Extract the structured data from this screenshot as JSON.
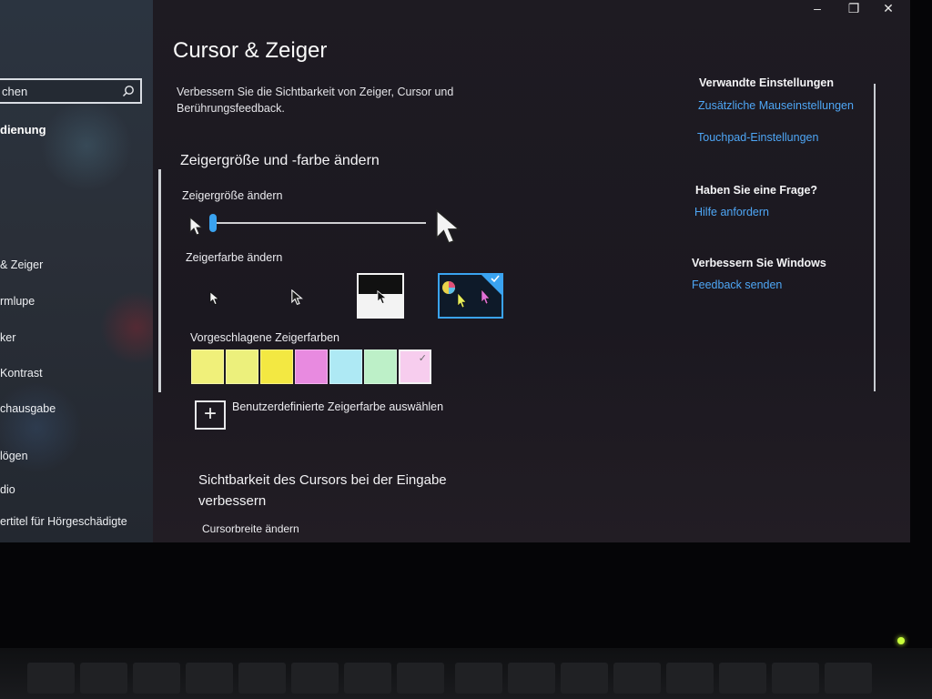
{
  "window": {
    "title": "Cursor & Zeiger",
    "minimize_glyph": "–",
    "restore_glyph": "❐",
    "close_glyph": "✕"
  },
  "sidebar": {
    "search_text": "chen",
    "group_label": "dienung",
    "items": [
      {
        "label": "& Zeiger"
      },
      {
        "label": "rmlupe"
      },
      {
        "label": "ker"
      },
      {
        "label": "Kontrast"
      },
      {
        "label": "chausgabe"
      },
      {
        "label": "lögen"
      },
      {
        "label": "dio"
      },
      {
        "label": "ertitel für Hörgeschädigte"
      }
    ]
  },
  "main": {
    "intro_text": "Verbessern Sie die Sichtbarkeit von Zeiger, Cursor und Berührungsfeedback.",
    "section1_title": "Zeigergröße und -farbe ändern",
    "size_label": "Zeigergröße ändern",
    "size_value": 0,
    "color_label": "Zeigerfarbe ändern",
    "color_options": [
      "white",
      "black",
      "inverted",
      "custom"
    ],
    "selected_color_option": "custom",
    "suggested_label": "Vorgeschlagene Zeigerfarben",
    "suggested_colors": [
      "#f0f07a",
      "#ecf07c",
      "#f3e842",
      "#e88ae0",
      "#aee9f4",
      "#bdf0c8",
      "#f7cdee"
    ],
    "selected_suggested_index": 6,
    "custom_color_label": "Benutzerdefinierte Zeigerfarbe auswählen",
    "section2_title": "Sichtbarkeit des Cursors bei der Eingabe verbessern",
    "cursor_width_label": "Cursorbreite ändern"
  },
  "related": {
    "heading": "Verwandte Einstellungen",
    "links": [
      "Zusätzliche Mauseinstellungen",
      "Touchpad-Einstellungen"
    ],
    "question_heading": "Haben Sie eine Frage?",
    "help_link": "Hilfe anfordern",
    "improve_heading": "Verbessern Sie Windows",
    "feedback_link": "Feedback senden"
  },
  "colors": {
    "accent": "#3aa3f0",
    "link": "#4ea6f5",
    "background": "#1e1b22"
  }
}
